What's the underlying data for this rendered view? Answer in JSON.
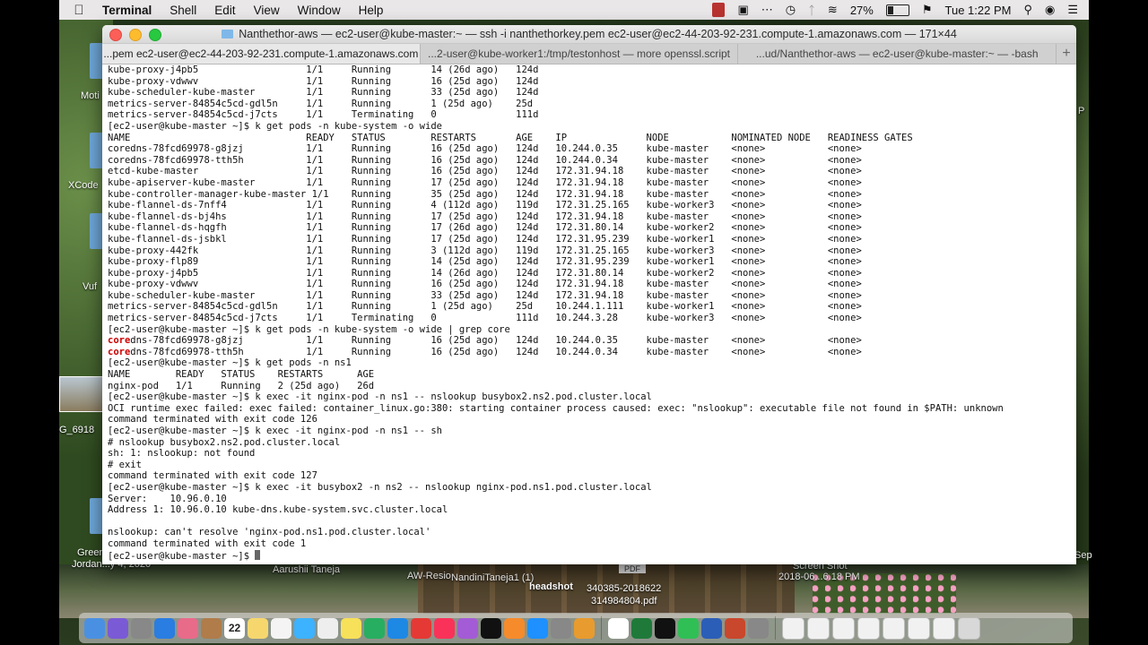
{
  "menubar": {
    "app_name": "Terminal",
    "menus": [
      "Shell",
      "Edit",
      "View",
      "Window",
      "Help"
    ],
    "battery_percent": "27%",
    "clock": "Tue 1:22 PM"
  },
  "desktop": {
    "labels": [
      "Moti",
      "XCode",
      "Vuf",
      "G_6918",
      "Green",
      "Jordan...y 4, 2020",
      "Aarushii Taneja",
      "AW-Resio",
      "NandiniTaneja1 (1)",
      "headshot",
      "340385-2018622",
      "314984804.pdf",
      "2018-06...6.18 PM",
      "Screen Shot",
      "PDF",
      "P",
      "Sep"
    ]
  },
  "window": {
    "title": "Nanthethor-aws — ec2-user@kube-master:~ — ssh -i nanthethorkey.pem ec2-user@ec2-44-203-92-231.compute-1.amazonaws.com — 171×44",
    "tabs": [
      "...pem ec2-user@ec2-44-203-92-231.compute-1.amazonaws.com",
      "...2-user@kube-worker1:/tmp/testonhost — more openssl.script",
      "...ud/Nanthethor-aws — ec2-user@kube-master:~ — -bash"
    ],
    "tab_add": "+"
  },
  "terminal": {
    "lines": [
      "kube-proxy-j4pb5                   1/1     Running       14 (26d ago)   124d",
      "kube-proxy-vdwwv                   1/1     Running       16 (25d ago)   124d",
      "kube-scheduler-kube-master         1/1     Running       33 (25d ago)   124d",
      "metrics-server-84854c5cd-gdl5n     1/1     Running       1 (25d ago)    25d",
      "metrics-server-84854c5cd-j7cts     1/1     Terminating   0              111d",
      "[ec2-user@kube-master ~]$ k get pods -n kube-system -o wide",
      "NAME                               READY   STATUS        RESTARTS       AGE    IP              NODE           NOMINATED NODE   READINESS GATES",
      "coredns-78fcd69978-g8jzj           1/1     Running       16 (25d ago)   124d   10.244.0.35     kube-master    <none>           <none>",
      "coredns-78fcd69978-tth5h           1/1     Running       16 (25d ago)   124d   10.244.0.34     kube-master    <none>           <none>",
      "etcd-kube-master                   1/1     Running       16 (25d ago)   124d   172.31.94.18    kube-master    <none>           <none>",
      "kube-apiserver-kube-master         1/1     Running       17 (25d ago)   124d   172.31.94.18    kube-master    <none>           <none>",
      "kube-controller-manager-kube-master 1/1    Running       35 (25d ago)   124d   172.31.94.18    kube-master    <none>           <none>",
      "kube-flannel-ds-7nff4              1/1     Running       4 (112d ago)   119d   172.31.25.165   kube-worker3   <none>           <none>",
      "kube-flannel-ds-bj4hs              1/1     Running       17 (25d ago)   124d   172.31.94.18    kube-master    <none>           <none>",
      "kube-flannel-ds-hqgfh              1/1     Running       17 (26d ago)   124d   172.31.80.14    kube-worker2   <none>           <none>",
      "kube-flannel-ds-jsbkl              1/1     Running       17 (25d ago)   124d   172.31.95.239   kube-worker1   <none>           <none>",
      "kube-proxy-442fk                   1/1     Running       3 (112d ago)   119d   172.31.25.165   kube-worker3   <none>           <none>",
      "kube-proxy-flp89                   1/1     Running       14 (25d ago)   124d   172.31.95.239   kube-worker1   <none>           <none>",
      "kube-proxy-j4pb5                   1/1     Running       14 (26d ago)   124d   172.31.80.14    kube-worker2   <none>           <none>",
      "kube-proxy-vdwwv                   1/1     Running       16 (25d ago)   124d   172.31.94.18    kube-master    <none>           <none>",
      "kube-scheduler-kube-master         1/1     Running       33 (25d ago)   124d   172.31.94.18    kube-master    <none>           <none>",
      "metrics-server-84854c5cd-gdl5n     1/1     Running       1 (25d ago)    25d    10.244.1.111    kube-worker1   <none>           <none>",
      "metrics-server-84854c5cd-j7cts     1/1     Terminating   0              111d   10.244.3.28     kube-worker3   <none>           <none>",
      "[ec2-user@kube-master ~]$ k get pods -n kube-system -o wide | grep core",
      "coredns-78fcd69978-g8jzj           1/1     Running       16 (25d ago)   124d   10.244.0.35     kube-master    <none>           <none>",
      "coredns-78fcd69978-tth5h           1/1     Running       16 (25d ago)   124d   10.244.0.34     kube-master    <none>           <none>",
      "[ec2-user@kube-master ~]$ k get pods -n ns1",
      "NAME        READY   STATUS    RESTARTS      AGE",
      "nginx-pod   1/1     Running   2 (25d ago)   26d",
      "[ec2-user@kube-master ~]$ k exec -it nginx-pod -n ns1 -- nslookup busybox2.ns2.pod.cluster.local",
      "OCI runtime exec failed: exec failed: container_linux.go:380: starting container process caused: exec: \"nslookup\": executable file not found in $PATH: unknown",
      "command terminated with exit code 126",
      "[ec2-user@kube-master ~]$ k exec -it nginx-pod -n ns1 -- sh",
      "# nslookup busybox2.ns2.pod.cluster.local",
      "sh: 1: nslookup: not found",
      "# exit",
      "command terminated with exit code 127",
      "[ec2-user@kube-master ~]$ k exec -it busybox2 -n ns2 -- nslookup nginx-pod.ns1.pod.cluster.local",
      "Server:    10.96.0.10",
      "Address 1: 10.96.0.10 kube-dns.kube-system.svc.cluster.local",
      "",
      "nslookup: can't resolve 'nginx-pod.ns1.pod.cluster.local'",
      "command terminated with exit code 1",
      "[ec2-user@kube-master ~]$ "
    ],
    "highlight_prefix": "core"
  },
  "dock": {
    "icons": [
      "finder-icon",
      "siri-icon",
      "launchpad-icon",
      "safari-icon",
      "photos-icon",
      "contacts-icon",
      "calendar-icon",
      "notes-icon",
      "reminders-icon",
      "messages-icon",
      "freeform-icon",
      "stickies-icon",
      "numbers-icon",
      "keynote-icon",
      "news-icon",
      "music-icon",
      "podcasts-icon",
      "tv-icon",
      "books-icon",
      "appstore-icon",
      "settings-icon",
      "photos-app-icon",
      "chrome-icon",
      "excel-icon",
      "terminal-icon",
      "facetime-icon",
      "word-icon",
      "powerpoint-icon",
      "preview-icon"
    ],
    "calendar_day": "22",
    "colors": [
      "#4a90e2",
      "#7b5ad6",
      "#888",
      "#2a7de1",
      "#e86b8a",
      "#b07c4a",
      "#fff",
      "#f5d76e",
      "#f4f4f4",
      "#3db2ff",
      "#eee",
      "#f7e05a",
      "#27ae60",
      "#1e88e5",
      "#e53935",
      "#fa3259",
      "#a35bd6",
      "#111",
      "#f58b2b",
      "#1e90ff",
      "#888",
      "#e89b2e",
      "#fff",
      "#1f7a3a",
      "#111",
      "#2fbf55",
      "#2b5eb7",
      "#c9472c",
      "#888"
    ]
  }
}
